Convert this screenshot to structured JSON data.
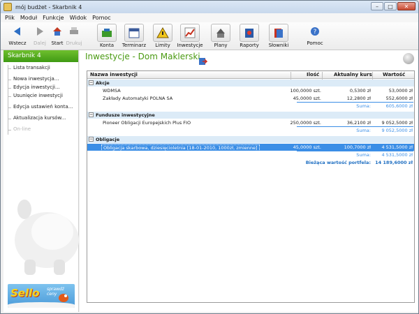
{
  "window": {
    "title": "mój budżet - Skarbnik 4"
  },
  "menu": [
    "Plik",
    "Moduł",
    "Funkcje",
    "Widok",
    "Pomoc"
  ],
  "toolbar": {
    "back": "Wstecz",
    "next": "Dalej",
    "start": "Start",
    "print": "Drukuj",
    "konta": "Konta",
    "terminarz": "Terminarz",
    "limity": "Limity",
    "inwestycje": "Inwestycje",
    "plany": "Plany",
    "raporty": "Raporty",
    "slowniki": "Słowniki",
    "pomoc": "Pomoc"
  },
  "sidebar": {
    "brand": "Skarbnik 4",
    "items": [
      "Lista transakcji",
      "Nowa inwestycja...",
      "Edycja inwestycji...",
      "Usunięcie inwestycji",
      "Edycja ustawień konta...",
      "Aktualizacja kursów...",
      "On-line"
    ],
    "ad_text": "Sello",
    "ad_sub": "sprawdź ceny"
  },
  "content": {
    "page_title": "Inwestycje - Dom Maklerski",
    "columns": {
      "name": "Nazwa inwestycji",
      "qty": "Ilość",
      "rate": "Aktualny kurs",
      "value": "Wartość"
    },
    "groups": [
      {
        "name": "Akcje",
        "rows": [
          {
            "name": "WDMSA",
            "qty": "100,0000 szt.",
            "rate": "0,5300 zł",
            "value": "53,0000 zł"
          },
          {
            "name": "Zakłady Automatyki POLNA SA",
            "qty": "45,0000 szt.",
            "rate": "12,2800 zł",
            "value": "552,6000 zł"
          }
        ],
        "sum_label": "Suma:",
        "sum_value": "605,6000 zł"
      },
      {
        "name": "Fundusze inwestycyjne",
        "rows": [
          {
            "name": "Pioneer Obligacji Europejskich Plus FIO",
            "qty": "250,0000 szt.",
            "rate": "36,2100 zł",
            "value": "9 052,5000 zł"
          }
        ],
        "sum_label": "Suma:",
        "sum_value": "9 052,5000 zł"
      },
      {
        "name": "Obligacje",
        "rows": [
          {
            "name": "Obligacja skarbowa, dziesięcioletnia [18-01-2010, 1000zł, zmienne]",
            "qty": "45,0000 szt.",
            "rate": "100,7000 zł",
            "value": "4 531,5000 zł"
          }
        ],
        "sum_label": "Suma:",
        "sum_value": "4 531,5000 zł"
      }
    ],
    "total_label": "Bieżąca wartość portfela:",
    "total_value": "14 189,6000 zł"
  },
  "colors": {
    "brand_green": "#4a9a12",
    "selection_blue": "#3b8ee6",
    "group_bg": "#dcebf7"
  }
}
